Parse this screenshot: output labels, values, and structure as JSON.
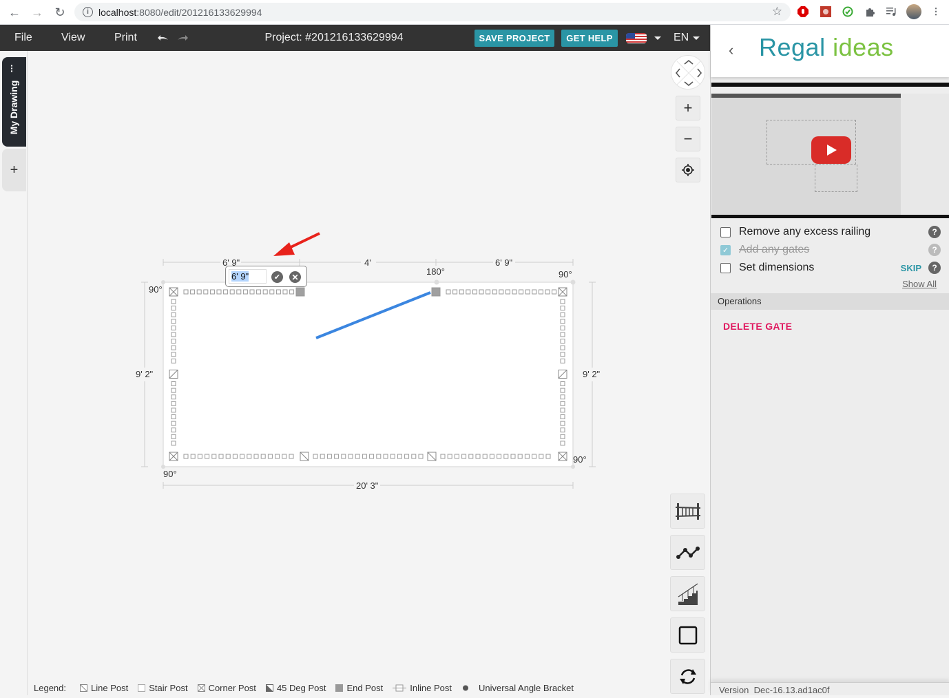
{
  "browser": {
    "url_host": "localhost",
    "url_path": ":8080/edit/201216133629994",
    "extensions": [
      "adblock-icon",
      "extension-red-icon",
      "check-extension-icon",
      "puzzle-icon",
      "media-queue-icon",
      "profile-avatar",
      "menu-dots-icon"
    ]
  },
  "header": {
    "menu": [
      "File",
      "View",
      "Print"
    ],
    "project_title": "Project: #201216133629994",
    "save_label": "SAVE PROJECT",
    "help_label": "GET HELP",
    "language": "EN",
    "colors": {
      "bar": "#333333",
      "accent": "#2a95a5"
    }
  },
  "left_tabs": {
    "active_tab": "My Drawing",
    "add_label": "+"
  },
  "canvas": {
    "dimensions": {
      "top_left": "6' 9\"",
      "top_mid": "4'",
      "top_right": "6' 9\"",
      "left": "9' 2\"",
      "right": "9' 2\"",
      "bottom": "20' 3\""
    },
    "angles": {
      "top_left": "90°",
      "top_mid": "180°",
      "top_right": "90°",
      "bottom_left": "90°",
      "bottom_right": "90°"
    },
    "edit_popup": {
      "value": "6' 9\""
    },
    "gate_color": "#3b86e0",
    "arrow_color": "#e8221b"
  },
  "tools": [
    "railing-tool",
    "polyline-tool",
    "stair-tool",
    "rectangle-tool",
    "rotate-tool"
  ],
  "legend": {
    "title": "Legend:",
    "items": [
      "Line Post",
      "Stair Post",
      "Corner Post",
      "45 Deg Post",
      "End Post",
      "Inline Post",
      "Universal Angle Bracket"
    ]
  },
  "panel": {
    "brand_a": "Regal",
    "brand_b": "ideas",
    "brand_colors": {
      "regal": "#2a95a5",
      "ideas": "#7cc242"
    },
    "tasks": [
      {
        "label": "Remove any excess railing",
        "done": false
      },
      {
        "label": "Add any gates",
        "done": true
      },
      {
        "label": "Set dimensions",
        "done": false
      }
    ],
    "skip_label": "SKIP",
    "show_all_label": "Show All",
    "operations_title": "Operations",
    "delete_gate_label": "DELETE GATE",
    "delete_color": "#e0195f",
    "version_label": "Version",
    "version_value": "Dec-16.13.ad1ac0f"
  }
}
